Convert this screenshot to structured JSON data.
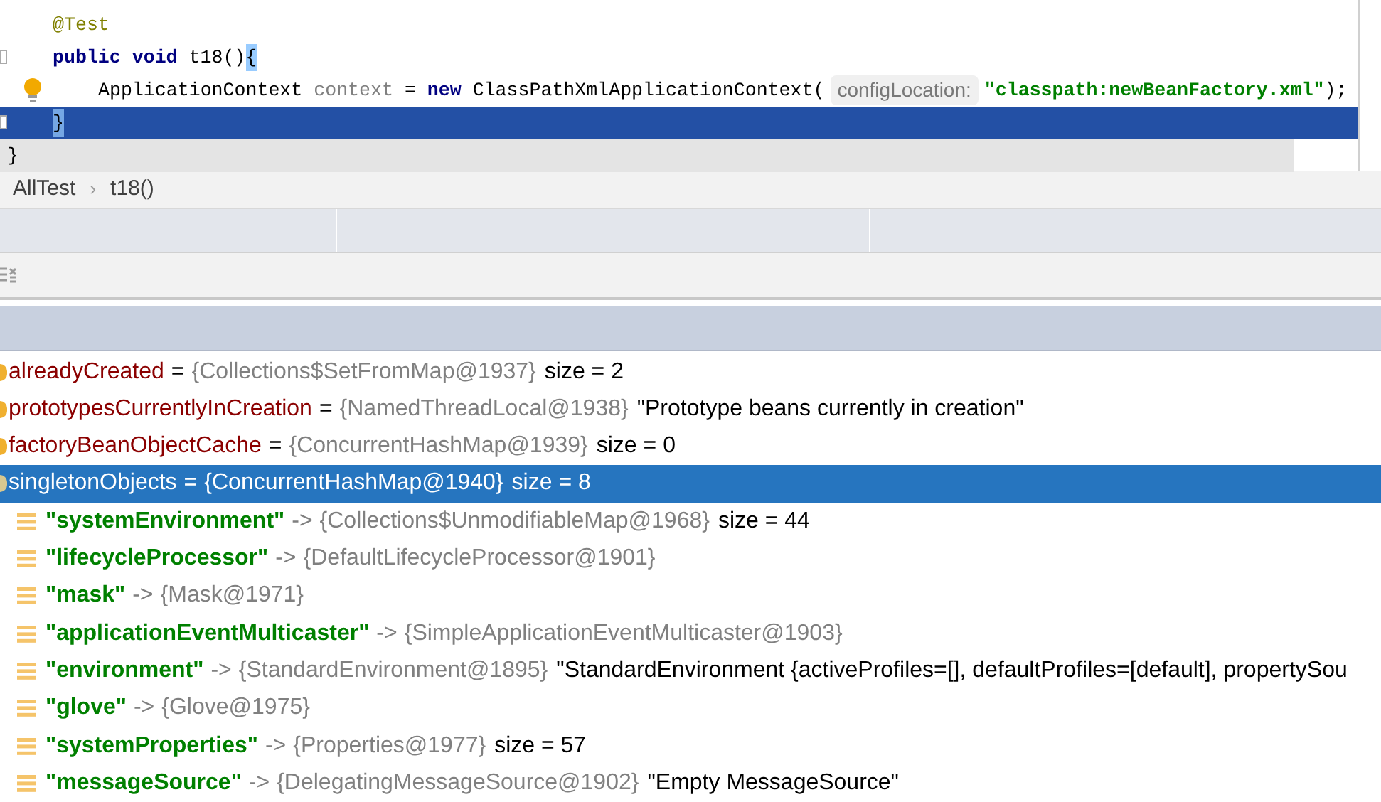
{
  "code": {
    "lines": [
      {
        "kind": "member",
        "selected": false,
        "bulb": false,
        "gutter": false,
        "segments": [
          {
            "kind": "annotation",
            "text": "@Test"
          }
        ]
      },
      {
        "kind": "member",
        "selected": false,
        "bulb": false,
        "gutter": true,
        "segments": [
          {
            "kind": "keyword",
            "text": "public void "
          },
          {
            "kind": "plain",
            "text": "t18()"
          },
          {
            "kind": "brace",
            "text": "{"
          }
        ]
      },
      {
        "kind": "statement",
        "selected": false,
        "bulb": true,
        "gutter": false,
        "segments": [
          {
            "kind": "plain",
            "text": "ApplicationContext "
          },
          {
            "kind": "unused",
            "text": "context"
          },
          {
            "kind": "plain",
            "text": " = "
          },
          {
            "kind": "keyword",
            "text": "new "
          },
          {
            "kind": "plain",
            "text": "ClassPathXmlApplicationContext("
          },
          {
            "kind": "hint",
            "text": "configLocation:"
          },
          {
            "kind": "string",
            "text": "\"classpath:newBeanFactory.xml\""
          },
          {
            "kind": "plain",
            "text": ");"
          }
        ]
      },
      {
        "kind": "member",
        "selected": true,
        "bulb": false,
        "gutter": true,
        "segments": [
          {
            "kind": "brace",
            "text": "}"
          }
        ]
      },
      {
        "kind": "class",
        "selected": false,
        "bulb": false,
        "gutter": false,
        "segments": [
          {
            "kind": "plain",
            "text": "}"
          }
        ]
      }
    ]
  },
  "breadcrumb": [
    {
      "label": "AllTest"
    },
    {
      "label": "t18()"
    }
  ],
  "breadcrumb_separator": "›",
  "variables": [
    {
      "kind": "field",
      "selected": false,
      "name": "alreadyCreated",
      "operator": "=",
      "type": "{Collections$SetFromMap@1937}",
      "extra": "size = 2"
    },
    {
      "kind": "field",
      "selected": false,
      "name": "prototypesCurrentlyInCreation",
      "operator": "=",
      "type": "{NamedThreadLocal@1938}",
      "extra": "\"Prototype beans currently in creation\""
    },
    {
      "kind": "field",
      "selected": false,
      "name": "factoryBeanObjectCache",
      "operator": "=",
      "type": "{ConcurrentHashMap@1939}",
      "extra": "size = 0"
    },
    {
      "kind": "field",
      "selected": true,
      "name": "singletonObjects",
      "operator": "=",
      "type": "{ConcurrentHashMap@1940}",
      "extra": "size = 8"
    },
    {
      "kind": "entry",
      "selected": false,
      "name": "\"systemEnvironment\"",
      "operator": "->",
      "type": "{Collections$UnmodifiableMap@1968}",
      "extra": "size = 44"
    },
    {
      "kind": "entry",
      "selected": false,
      "name": "\"lifecycleProcessor\"",
      "operator": "->",
      "type": "{DefaultLifecycleProcessor@1901}"
    },
    {
      "kind": "entry",
      "selected": false,
      "name": "\"mask\"",
      "operator": "->",
      "type": "{Mask@1971}"
    },
    {
      "kind": "entry",
      "selected": false,
      "name": "\"applicationEventMulticaster\"",
      "operator": "->",
      "type": "{SimpleApplicationEventMulticaster@1903}"
    },
    {
      "kind": "entry",
      "selected": false,
      "name": "\"environment\"",
      "operator": "->",
      "type": "{StandardEnvironment@1895}",
      "extra": "\"StandardEnvironment {activeProfiles=[], defaultProfiles=[default], propertySou"
    },
    {
      "kind": "entry",
      "selected": false,
      "name": "\"glove\"",
      "operator": "->",
      "type": "{Glove@1975}"
    },
    {
      "kind": "entry",
      "selected": false,
      "name": "\"systemProperties\"",
      "operator": "->",
      "type": "{Properties@1977}",
      "extra": "size = 57"
    },
    {
      "kind": "entry",
      "selected": false,
      "name": "\"messageSource\"",
      "operator": "->",
      "type": "{DelegatingMessageSource@1902}",
      "extra": "\"Empty MessageSource\""
    }
  ]
}
